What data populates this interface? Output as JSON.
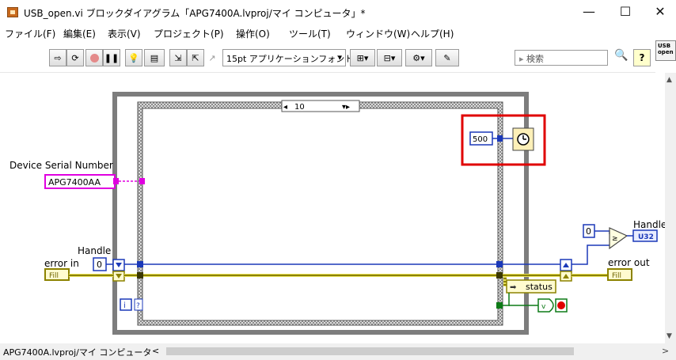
{
  "window": {
    "title": "USB_open.vi ブロックダイアグラム「APG7400A.lvproj/マイ コンピュータ」*",
    "controls": {
      "minimize": "—",
      "maximize": "☐",
      "close": "✕"
    }
  },
  "menu": {
    "items": [
      "ファイル(F)",
      "編集(E)",
      "表示(V)",
      "プロジェクト(P)",
      "操作(O)",
      "ツール(T)",
      "ウィンドウ(W)",
      "ヘルプ(H)"
    ]
  },
  "vi_icon": {
    "line1": "USB",
    "line2": "open"
  },
  "toolbar": {
    "font_dropdown": "15pt アプリケーションフォント",
    "search_placeholder": "検索",
    "help_label": "?"
  },
  "diagram": {
    "case_selector": "10",
    "labels": {
      "device_serial": "Device Serial Number",
      "device_serial_value": "APG7400AA",
      "handle_in": "Handle",
      "error_in": "error in",
      "handle_in_const": "0",
      "handle_out": "Handle",
      "handle_out_type": "U32",
      "handle_out_const": "0",
      "error_out": "error out",
      "wait_const": "500",
      "status": "status",
      "iteration": "i",
      "stop_terminal": "?",
      "cluster_in_label": "Fill",
      "cluster_out_label": "Fill"
    }
  },
  "statusbar": {
    "path": "APG7400A.lvproj/マイ コンピュータ",
    "left_arrow": "<",
    "right_arrow": ">"
  },
  "colors": {
    "highlight": "#e00000",
    "error_wire": "#8c8200",
    "numeric_wire": "#1b39b9",
    "string_wire": "#d000d0",
    "loop_border": "#7a7a7a",
    "bool_wire": "#0d7a17"
  }
}
